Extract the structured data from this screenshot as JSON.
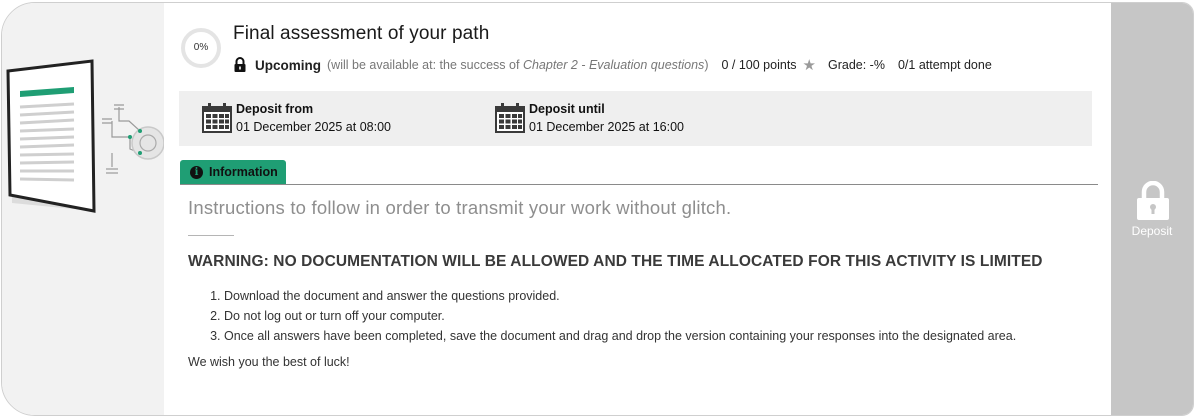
{
  "activity": {
    "progress": "0%",
    "progress_fraction": 0,
    "title": "Final assessment of your path",
    "status": "Upcoming",
    "availability_prefix": "(will be available at: the success of ",
    "availability_chapter": "Chapter 2 - Evaluation questions",
    "availability_suffix": ")",
    "points": "0 / 100 points",
    "grade": "Grade: -%",
    "attempts": "0/1 attempt done"
  },
  "deposit": {
    "from_label": "Deposit from",
    "from_value": "01 December 2025 at 08:00",
    "until_label": "Deposit until",
    "until_value": "01 December 2025 at 16:00"
  },
  "tab": {
    "label": "Information"
  },
  "instructions": {
    "heading": "Instructions to follow in order to transmit your work without glitch.",
    "warning": "WARNING: NO DOCUMENTATION WILL BE ALLOWED AND THE TIME ALLOCATED FOR THIS ACTIVITY IS LIMITED",
    "steps": [
      "Download the document and answer the questions provided.",
      "Do not log out or turn off your computer.",
      "Once all answers have been completed, save the document and drag and drop the version containing your responses into the designated area."
    ],
    "closing": "We wish you the best of luck!"
  },
  "side_action": {
    "label": "Deposit"
  },
  "colors": {
    "accent": "#1f9e74",
    "side_panel": "#c6c6c6",
    "deposit_bar": "#efefef"
  }
}
